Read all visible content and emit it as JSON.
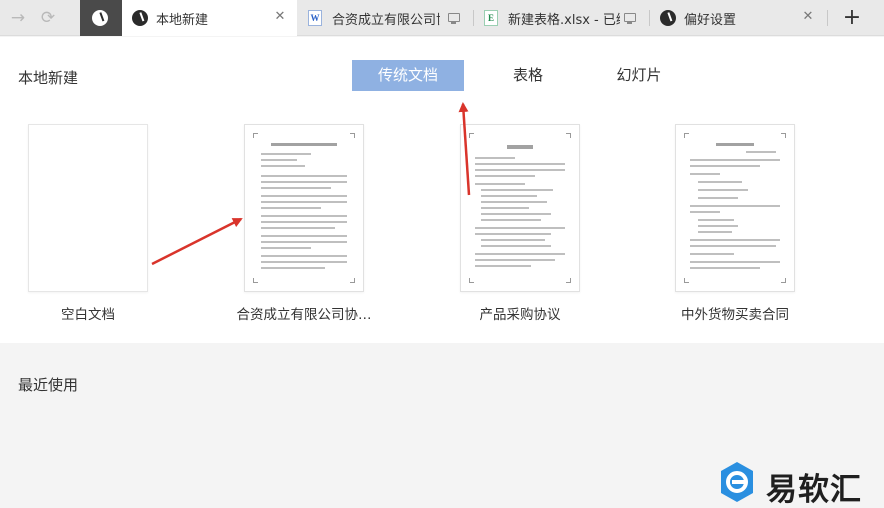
{
  "tabs": [
    {
      "label": "本地新建",
      "active": true
    },
    {
      "label": "合资成立有限公司协议书",
      "icon": "W"
    },
    {
      "label": "新建表格.xlsx - 已编辑",
      "icon": "E"
    },
    {
      "label": "偏好设置"
    }
  ],
  "panel": {
    "title": "本地新建",
    "types": [
      "传统文档",
      "表格",
      "幻灯片"
    ],
    "templates": [
      "空白文档",
      "合资成立有限公司协…",
      "产品采购协议",
      "中外货物买卖合同"
    ]
  },
  "recent": {
    "title": "最近使用"
  },
  "watermark": {
    "text": "易软汇"
  },
  "colors": {
    "accent": "#8fb1e2",
    "arrow": "#d9342b",
    "watermark_blue": "#2a8fe0"
  }
}
